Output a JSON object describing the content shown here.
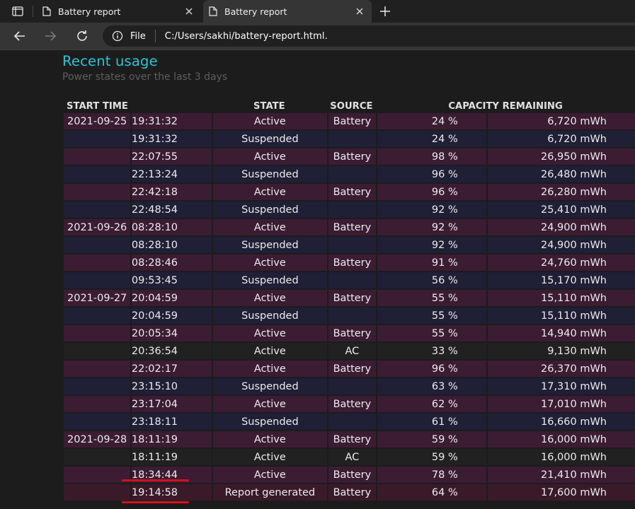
{
  "browser": {
    "tabs": [
      {
        "label": "Battery report",
        "active": false
      },
      {
        "label": "Battery report",
        "active": true
      }
    ],
    "address": {
      "scheme_label": "File",
      "url": "C:/Users/sakhi/battery-report.html."
    }
  },
  "section": {
    "title": "Recent usage",
    "subtitle": "Power states over the last 3 days"
  },
  "table": {
    "headers": {
      "start_time": "START TIME",
      "state": "STATE",
      "source": "SOURCE",
      "capacity": "CAPACITY REMAINING"
    },
    "rows": [
      {
        "date": "2021-09-25",
        "time": "19:31:32",
        "state": "Active",
        "source": "Battery",
        "pct": "24 %",
        "cap": "6,720 mWh",
        "style": "purple"
      },
      {
        "date": "",
        "time": "19:31:32",
        "state": "Suspended",
        "source": "",
        "pct": "24 %",
        "cap": "6,720 mWh",
        "style": "navy"
      },
      {
        "date": "",
        "time": "22:07:55",
        "state": "Active",
        "source": "Battery",
        "pct": "98 %",
        "cap": "26,950 mWh",
        "style": "purple"
      },
      {
        "date": "",
        "time": "22:13:24",
        "state": "Suspended",
        "source": "",
        "pct": "96 %",
        "cap": "26,480 mWh",
        "style": "navy"
      },
      {
        "date": "",
        "time": "22:42:18",
        "state": "Active",
        "source": "Battery",
        "pct": "96 %",
        "cap": "26,280 mWh",
        "style": "purple"
      },
      {
        "date": "",
        "time": "22:48:54",
        "state": "Suspended",
        "source": "",
        "pct": "92 %",
        "cap": "25,410 mWh",
        "style": "navy"
      },
      {
        "date": "2021-09-26",
        "time": "08:28:10",
        "state": "Active",
        "source": "Battery",
        "pct": "92 %",
        "cap": "24,900 mWh",
        "style": "purple"
      },
      {
        "date": "",
        "time": "08:28:10",
        "state": "Suspended",
        "source": "",
        "pct": "92 %",
        "cap": "24,900 mWh",
        "style": "navy"
      },
      {
        "date": "",
        "time": "08:28:46",
        "state": "Active",
        "source": "Battery",
        "pct": "91 %",
        "cap": "24,760 mWh",
        "style": "purple"
      },
      {
        "date": "",
        "time": "09:53:45",
        "state": "Suspended",
        "source": "",
        "pct": "56 %",
        "cap": "15,170 mWh",
        "style": "navy"
      },
      {
        "date": "2021-09-27",
        "time": "20:04:59",
        "state": "Active",
        "source": "Battery",
        "pct": "55 %",
        "cap": "15,110 mWh",
        "style": "purple"
      },
      {
        "date": "",
        "time": "20:04:59",
        "state": "Suspended",
        "source": "",
        "pct": "55 %",
        "cap": "15,110 mWh",
        "style": "navy"
      },
      {
        "date": "",
        "time": "20:05:34",
        "state": "Active",
        "source": "Battery",
        "pct": "55 %",
        "cap": "14,940 mWh",
        "style": "purple"
      },
      {
        "date": "",
        "time": "20:36:54",
        "state": "Active",
        "source": "AC",
        "pct": "33 %",
        "cap": "9,130 mWh",
        "style": "dark"
      },
      {
        "date": "",
        "time": "22:02:17",
        "state": "Active",
        "source": "Battery",
        "pct": "96 %",
        "cap": "26,370 mWh",
        "style": "purple"
      },
      {
        "date": "",
        "time": "23:15:10",
        "state": "Suspended",
        "source": "",
        "pct": "63 %",
        "cap": "17,310 mWh",
        "style": "navy"
      },
      {
        "date": "",
        "time": "23:17:04",
        "state": "Active",
        "source": "Battery",
        "pct": "62 %",
        "cap": "17,010 mWh",
        "style": "purple"
      },
      {
        "date": "",
        "time": "23:18:11",
        "state": "Suspended",
        "source": "",
        "pct": "61 %",
        "cap": "16,660 mWh",
        "style": "navy"
      },
      {
        "date": "2021-09-28",
        "time": "18:11:19",
        "state": "Active",
        "source": "Battery",
        "pct": "59 %",
        "cap": "16,000 mWh",
        "style": "purple"
      },
      {
        "date": "",
        "time": "18:11:19",
        "state": "Active",
        "source": "AC",
        "pct": "59 %",
        "cap": "16,000 mWh",
        "style": "dark"
      },
      {
        "date": "",
        "time": "18:34:44",
        "state": "Active",
        "source": "Battery",
        "pct": "78 %",
        "cap": "21,410 mWh",
        "style": "purple"
      },
      {
        "date": "",
        "time": "19:14:58",
        "state": "Report generated",
        "source": "Battery",
        "pct": "64 %",
        "cap": "17,600 mWh",
        "style": "last"
      }
    ]
  },
  "annotations": {
    "underline_color": "#d8101a"
  },
  "icons": [
    "tab-actions-icon",
    "page-icon",
    "close-icon",
    "new-tab-icon",
    "back-icon",
    "forward-icon",
    "refresh-icon",
    "info-icon"
  ]
}
